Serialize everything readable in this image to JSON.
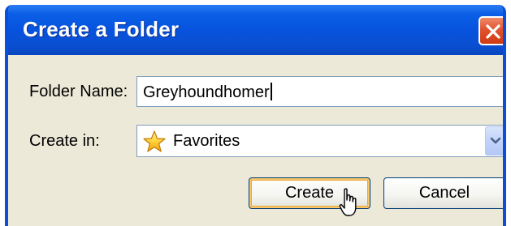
{
  "window": {
    "title": "Create a Folder",
    "close_icon": "close-icon"
  },
  "form": {
    "folder_name_label": "Folder Name:",
    "folder_name_value": "Greyhoundhomer",
    "create_in_label": "Create in:",
    "create_in_value": "Favorites",
    "create_in_icon": "star-icon"
  },
  "buttons": {
    "create": "Create",
    "cancel": "Cancel"
  },
  "colors": {
    "titlebar": "#0753de",
    "close_button": "#e0532e",
    "dialog_background": "#ece9d8",
    "default_button_highlight": "#f7c76a"
  }
}
